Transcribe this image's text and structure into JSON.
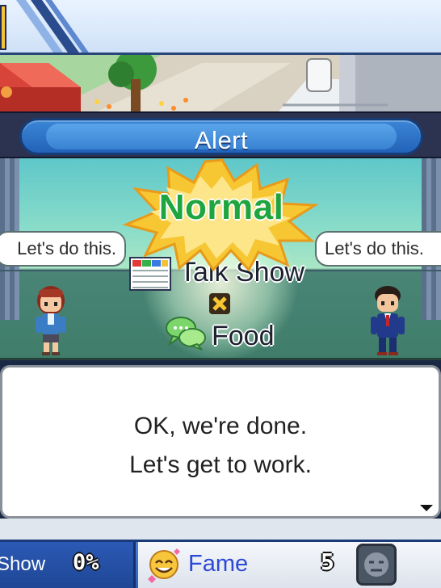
{
  "alert": {
    "title": "Alert"
  },
  "stage": {
    "rating": "Normal",
    "left_speech": "Let's do this.",
    "right_speech": "Let's do this.",
    "show_type_icon": "schedule-board-icon",
    "show_type": "Talk Show",
    "compatibility_icon": "x-mark-icon",
    "topic_icon": "chat-bubbles-icon",
    "topic": "Food"
  },
  "message": {
    "line1": "OK, we're done.",
    "line2": "Let's get to work."
  },
  "status_bar": {
    "show_label": "Show",
    "show_percent": "0%",
    "fame_icon": "smiley-face-icon",
    "fame_label": "Fame",
    "fame_value": "5",
    "avatar_icon": "gray-face-icon"
  },
  "colors": {
    "alert_blue": "#2f6fc8",
    "rating_green": "#1fa53e",
    "burst_yellow": "#f6c733",
    "fame_text": "#2c49d6"
  }
}
